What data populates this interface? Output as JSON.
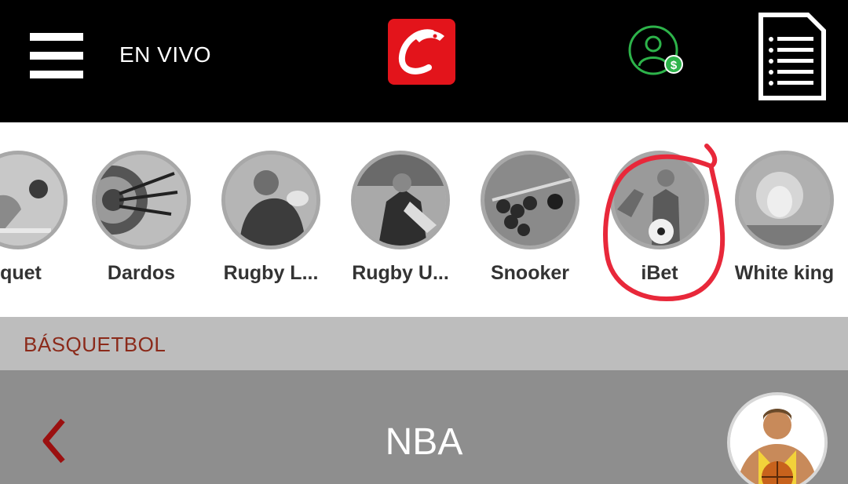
{
  "header": {
    "live_label": "EN VIVO",
    "menu_icon": "hamburger-menu-icon",
    "logo_icon": "horse-head-logo",
    "account_icon": "user-balance-icon",
    "betslip_icon": "document-list-icon",
    "logo_color": "#e3141b",
    "account_color": "#2db34a"
  },
  "sports": [
    {
      "label": "iquet",
      "icon": "cricket-icon"
    },
    {
      "label": "Dardos",
      "icon": "darts-icon"
    },
    {
      "label": "Rugby L...",
      "icon": "rugby-league-icon"
    },
    {
      "label": "Rugby U...",
      "icon": "rugby-union-icon"
    },
    {
      "label": "Snooker",
      "icon": "snooker-icon"
    },
    {
      "label": "iBet",
      "icon": "ibet-icon",
      "highlighted": true
    },
    {
      "label": "White king",
      "icon": "white-king-icon"
    }
  ],
  "section": {
    "title": "BÁSQUETBOL"
  },
  "league": {
    "title": "NBA",
    "back_icon": "chevron-left-icon",
    "avatar_icon": "basketball-player-avatar"
  },
  "colors": {
    "header_bg": "#000000",
    "section_bg": "#bdbdbd",
    "section_text": "#8b2a1a",
    "league_bg": "#8e8e8e",
    "annotation": "#e8283a"
  }
}
